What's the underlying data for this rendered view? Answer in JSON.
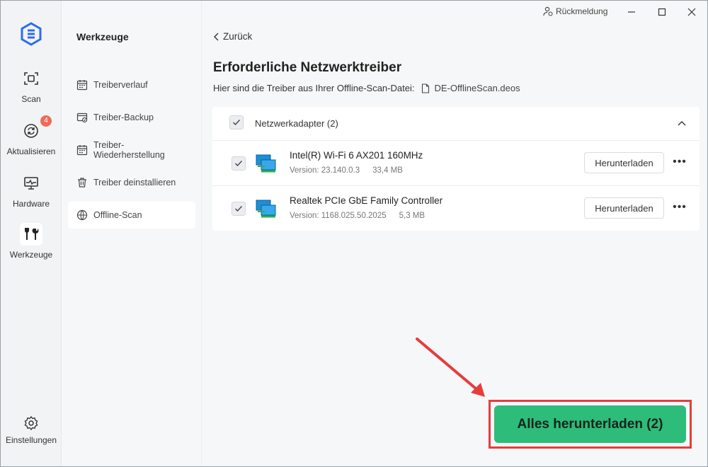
{
  "titlebar": {
    "feedback_label": "Rückmeldung"
  },
  "rail": {
    "items": [
      {
        "label": "Scan",
        "icon": "scan-icon"
      },
      {
        "label": "Aktualisieren",
        "icon": "refresh-icon",
        "badge": "4"
      },
      {
        "label": "Hardware",
        "icon": "monitor-icon"
      },
      {
        "label": "Werkzeuge",
        "icon": "tools-icon",
        "active": true
      }
    ],
    "settings_label": "Einstellungen"
  },
  "panel": {
    "title": "Werkzeuge",
    "items": [
      {
        "label": "Treiberverlauf",
        "icon": "calendar-icon"
      },
      {
        "label": "Treiber-Backup",
        "icon": "backup-icon"
      },
      {
        "label": "Treiber-Wiederherstellung",
        "icon": "restore-icon"
      },
      {
        "label": "Treiber deinstallieren",
        "icon": "trash-icon"
      },
      {
        "label": "Offline-Scan",
        "icon": "globe-icon",
        "active": true
      }
    ]
  },
  "main": {
    "back_label": "Zurück",
    "title": "Erforderliche Netzwerktreiber",
    "subtitle": "Hier sind die Treiber aus Ihrer Offline-Scan-Datei:",
    "filename": "DE-OfflineScan.deos",
    "group_label": "Netzwerkadapter (2)",
    "drivers": [
      {
        "name": "Intel(R) Wi-Fi 6 AX201 160MHz",
        "version": "Version: 23.140.0.3",
        "size": "33,4 MB",
        "button": "Herunterladen"
      },
      {
        "name": "Realtek PCIe GbE Family Controller",
        "version": "Version: 1168.025.50.2025",
        "size": "5,3 MB",
        "button": "Herunterladen"
      }
    ],
    "download_all_label": "Alles herunterladen (2)"
  },
  "colors": {
    "accent_green": "#2ebc7a",
    "highlight_red": "#e63c3c",
    "badge_red": "#f06a5a",
    "logo_blue": "#2d6cf0"
  }
}
